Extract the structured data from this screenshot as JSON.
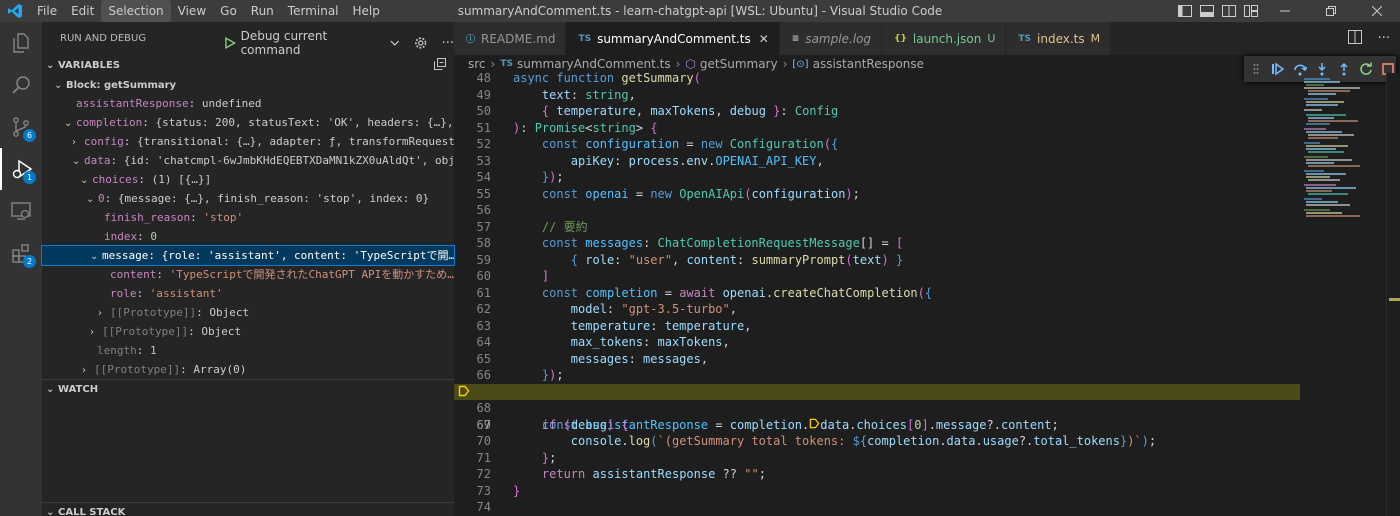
{
  "window": {
    "title": "summaryAndComment.ts - learn-chatgpt-api [WSL: Ubuntu] - Visual Studio Code",
    "menu": [
      "File",
      "Edit",
      "Selection",
      "View",
      "Go",
      "Run",
      "Terminal",
      "Help"
    ],
    "active_menu": "Selection"
  },
  "activity_bar": {
    "items": [
      {
        "name": "explorer",
        "badge": ""
      },
      {
        "name": "search",
        "badge": ""
      },
      {
        "name": "source-control",
        "badge": "6"
      },
      {
        "name": "run-and-debug",
        "badge": "1"
      },
      {
        "name": "remote-explorer",
        "badge": ""
      },
      {
        "name": "extensions",
        "badge": "2"
      }
    ]
  },
  "sidebar": {
    "header": "RUN AND DEBUG",
    "config_label": "Debug current command",
    "variables_title": "VARIABLES",
    "watch_title": "WATCH",
    "callstack_title": "CALL STACK",
    "rows": [
      {
        "text": "Block: getSummary"
      },
      {
        "key": "assistantResponse",
        "value": "undefined"
      },
      {
        "key": "completion",
        "value": "{status: 200, statusText: 'OK', headers: {…}, c…"
      },
      {
        "key": "config",
        "value": "{transitional: {…}, adapter: ƒ, transformRequest: …"
      },
      {
        "key": "data",
        "value": "{id: 'chatcmpl-6wJmbKHdEQEBTXDaMN1kZX0uAldQt', objec…"
      },
      {
        "key": "choices",
        "value": "(1) [{…}]"
      },
      {
        "key": "0",
        "value": "{message: {…}, finish_reason: 'stop', index: 0}"
      },
      {
        "key": "finish_reason",
        "value": "'stop'"
      },
      {
        "key": "index",
        "value": "0"
      },
      {
        "key": "message",
        "value": "{role: 'assistant', content: 'TypeScriptで開…"
      },
      {
        "key": "content",
        "value": "'TypeScriptで開発されたChatGPT APIを動かすため…"
      },
      {
        "key": "role",
        "value": "'assistant'"
      },
      {
        "key": "[[Prototype]]",
        "value": "Object"
      },
      {
        "key": "[[Prototype]]",
        "value": "Object"
      },
      {
        "key": "length",
        "value": "1"
      },
      {
        "key": "[[Prototype]]",
        "value": "Array(0)"
      }
    ]
  },
  "tabs": [
    {
      "icon": "info-icon",
      "label": "README.md",
      "badge": "",
      "active": false
    },
    {
      "icon": "TS",
      "label": "summaryAndComment.ts",
      "badge": "",
      "active": true
    },
    {
      "icon": "lines-icon",
      "label": "sample.log",
      "badge": "",
      "active": false
    },
    {
      "icon": "{}",
      "label": "launch.json",
      "badge": "U",
      "active": false
    },
    {
      "icon": "TS",
      "label": "index.ts",
      "badge": "M",
      "active": false
    }
  ],
  "breadcrumbs": [
    "src",
    "summaryAndComment.ts",
    "getSummary",
    "assistantResponse"
  ],
  "editor": {
    "current_line": 67,
    "lines": [
      {
        "n": "48",
        "code": "async function getSummary("
      },
      {
        "n": "49",
        "code": "    text: string,"
      },
      {
        "n": "50",
        "code": "    { temperature, maxTokens, debug }: Config"
      },
      {
        "n": "51",
        "code": "): Promise<string> {"
      },
      {
        "n": "52",
        "code": "    const configuration = new Configuration({"
      },
      {
        "n": "53",
        "code": "        apiKey: process.env.OPENAI_API_KEY,"
      },
      {
        "n": "54",
        "code": "    });"
      },
      {
        "n": "55",
        "code": "    const openai = new OpenAIApi(configuration);"
      },
      {
        "n": "56",
        "code": ""
      },
      {
        "n": "57",
        "code": "    // 要約"
      },
      {
        "n": "58",
        "code": "    const messages: ChatCompletionRequestMessage[] = ["
      },
      {
        "n": "59",
        "code": "        { role: \"user\", content: summaryPrompt(text) }"
      },
      {
        "n": "60",
        "code": "    ]"
      },
      {
        "n": "61",
        "code": "    const completion = await openai.createChatCompletion({"
      },
      {
        "n": "62",
        "code": "        model: \"gpt-3.5-turbo\","
      },
      {
        "n": "63",
        "code": "        temperature: temperature,"
      },
      {
        "n": "64",
        "code": "        max_tokens: maxTokens,"
      },
      {
        "n": "65",
        "code": "        messages: messages,"
      },
      {
        "n": "66",
        "code": "    });"
      },
      {
        "n": "67",
        "code": "    const assistantResponse = completion.data.choices[0].message?.content;"
      },
      {
        "n": "68",
        "code": ""
      },
      {
        "n": "69",
        "code": "    if (debug) {"
      },
      {
        "n": "70",
        "code": "        console.log(`(getSummary total tokens: ${completion.data.usage?.total_tokens})`);"
      },
      {
        "n": "71",
        "code": "    };"
      },
      {
        "n": "72",
        "code": "    return assistantResponse ?? \"\";"
      },
      {
        "n": "73",
        "code": "}"
      },
      {
        "n": "74",
        "code": ""
      }
    ]
  },
  "colors": {
    "accent": "#007acc",
    "current_line": "#4b4b18",
    "breakpoint_arrow": "#ffcc00"
  }
}
